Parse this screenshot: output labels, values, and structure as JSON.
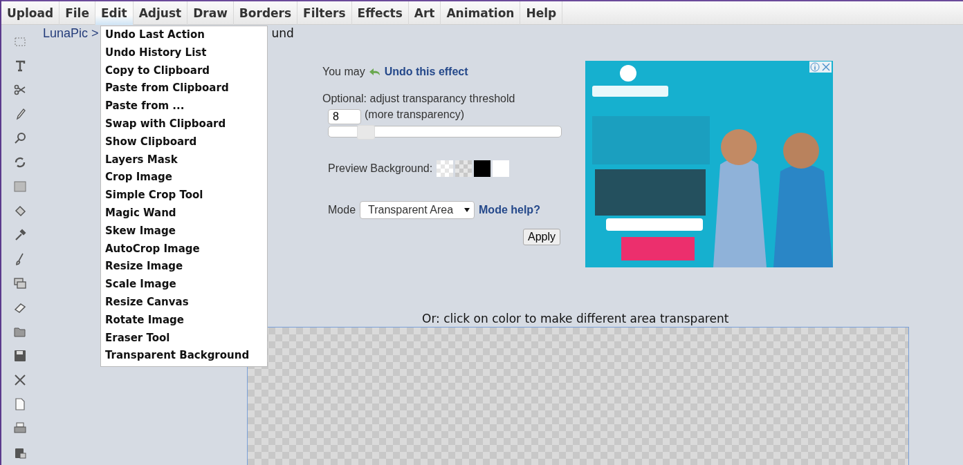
{
  "menu_bar": [
    {
      "label": "Upload",
      "selected": false
    },
    {
      "label": "File",
      "selected": false
    },
    {
      "label": "Edit",
      "selected": true
    },
    {
      "label": "Adjust",
      "selected": false
    },
    {
      "label": "Draw",
      "selected": false
    },
    {
      "label": "Borders",
      "selected": false
    },
    {
      "label": "Filters",
      "selected": false
    },
    {
      "label": "Effects",
      "selected": false
    },
    {
      "label": "Art",
      "selected": false
    },
    {
      "label": "Animation",
      "selected": false
    },
    {
      "label": "Help",
      "selected": false
    }
  ],
  "edit_menu": [
    "Undo Last Action",
    "Undo History List",
    "Copy to Clipboard",
    "Paste from Clipboard",
    "Paste from ...",
    "Swap with Clipboard",
    "Show Clipboard",
    "Layers Mask",
    "Crop Image",
    "Simple Crop Tool",
    "Magic Wand",
    "Skew Image",
    "AutoCrop Image",
    "Resize Image",
    "Scale Image",
    "Resize Canvas",
    "Rotate Image",
    "Eraser Tool",
    "Transparent Background"
  ],
  "breadcrumb": {
    "link": "LunaPic >",
    "tail": "und"
  },
  "undo": {
    "prefix": "You may",
    "link": "Undo this effect"
  },
  "threshold": {
    "label": "Optional: adjust transparancy threshold",
    "value": "8",
    "hint": "(more transparency)",
    "level": 0.16
  },
  "preview": {
    "label": "Preview Background:",
    "swatches": [
      {
        "kind": "checker",
        "color": "#ffffff"
      },
      {
        "kind": "checker",
        "color": "#c8c8c8"
      },
      {
        "kind": "solid",
        "color": "#000000"
      },
      {
        "kind": "solid",
        "color": "#ffffff"
      }
    ]
  },
  "mode": {
    "label": "Mode",
    "value": "Transparent Area",
    "help": "Mode help?"
  },
  "apply_button": "Apply",
  "canvas_caption": "Or: click on color to make different area transparent"
}
